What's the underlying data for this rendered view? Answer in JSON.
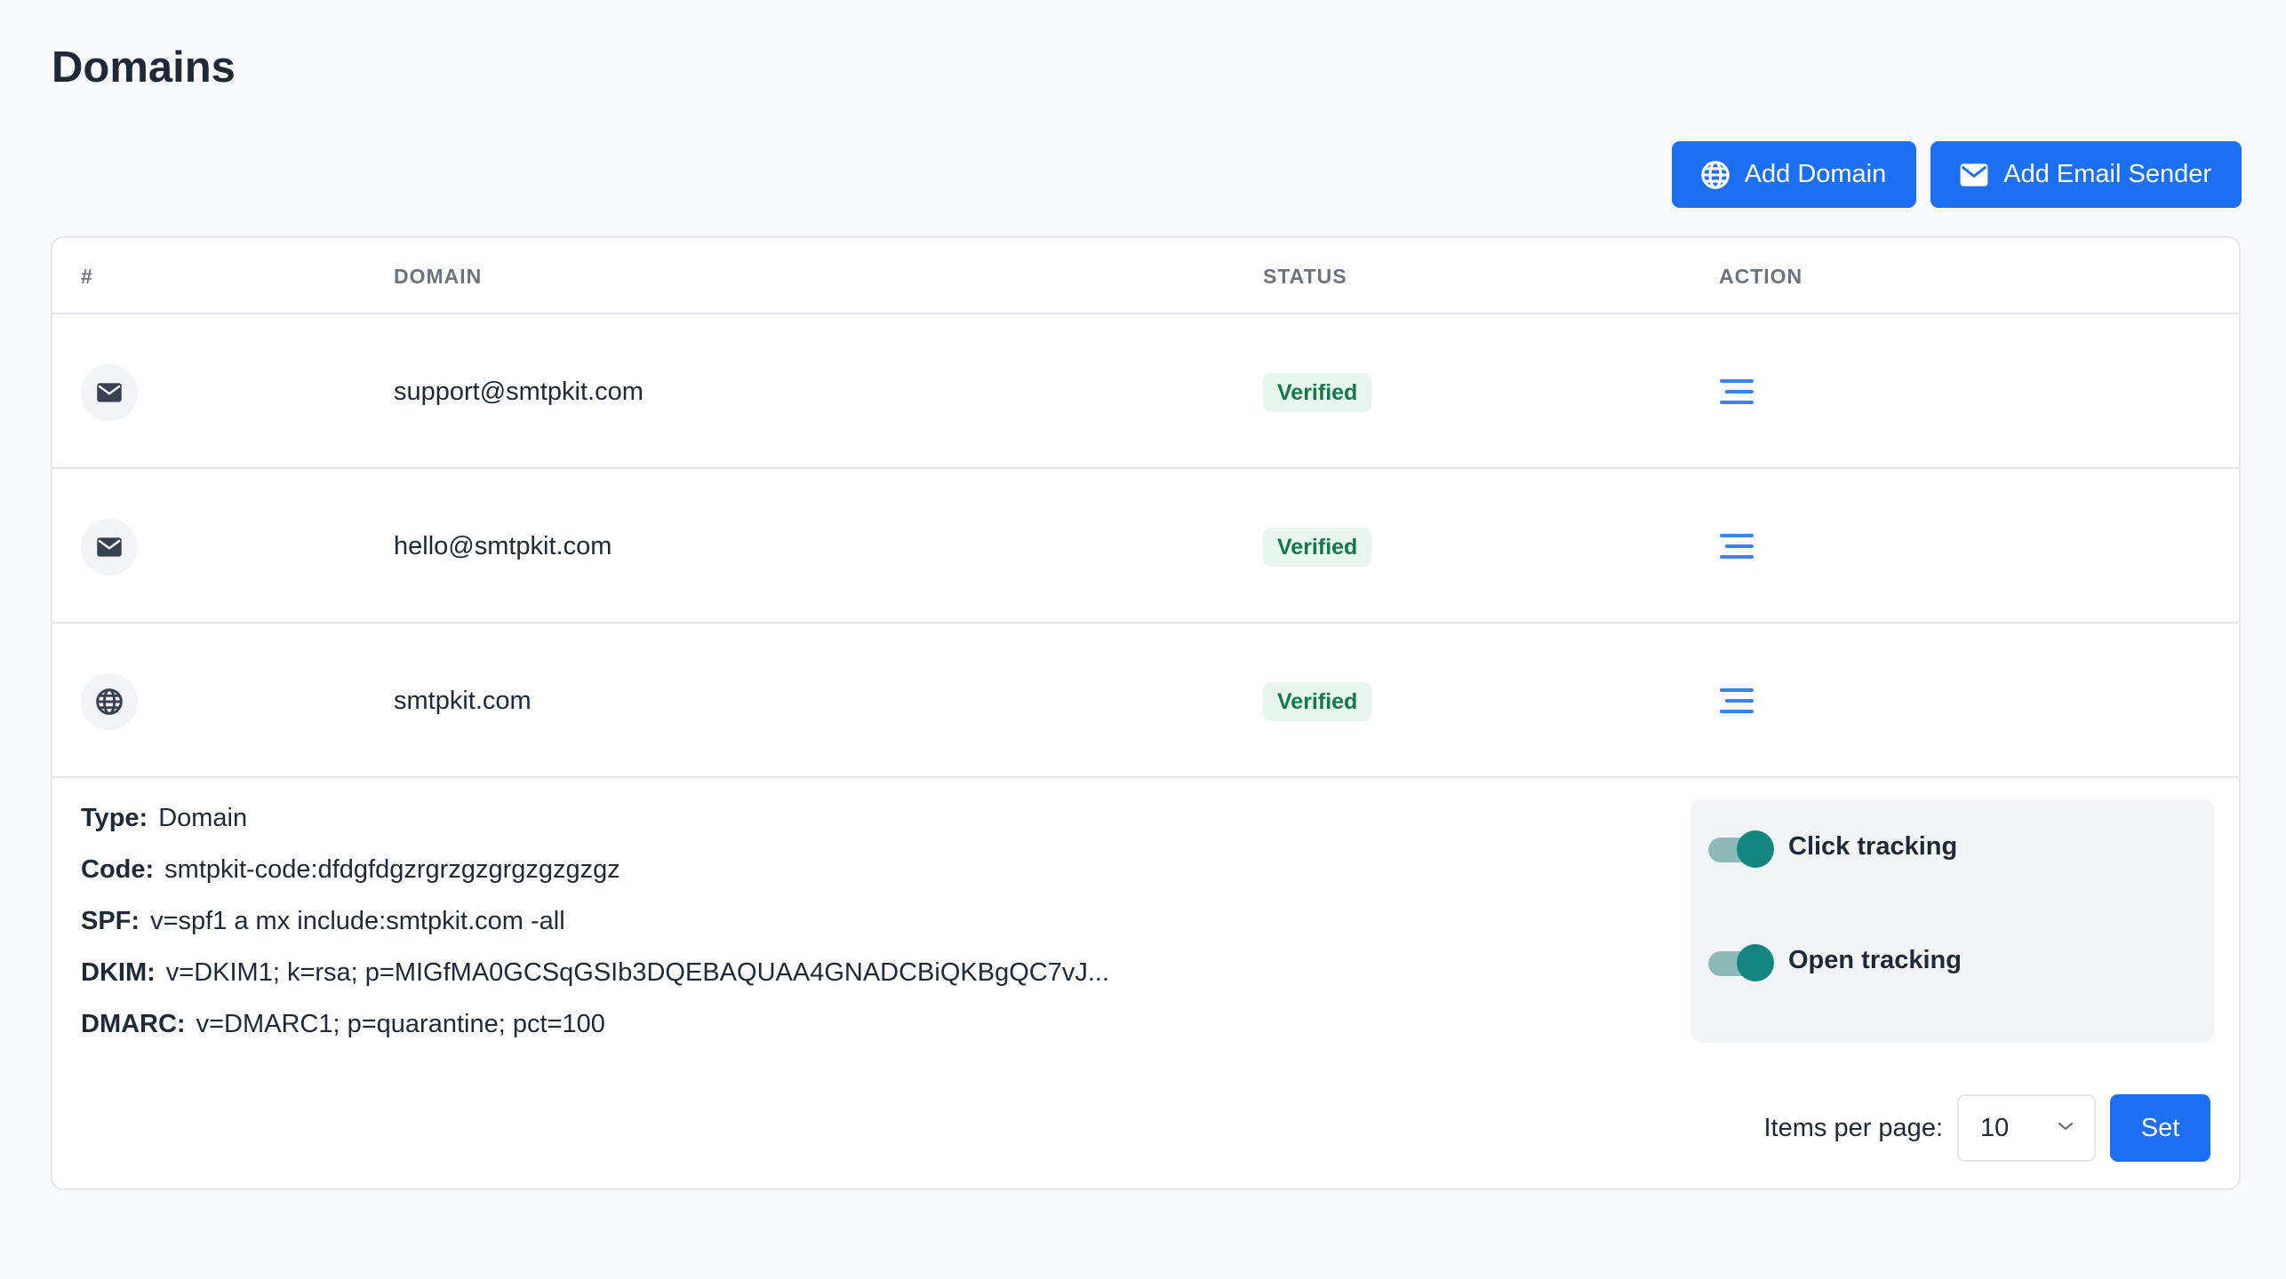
{
  "page": {
    "title": "Domains"
  },
  "toolbar": {
    "add_domain_label": "Add Domain",
    "add_sender_label": "Add Email Sender"
  },
  "table": {
    "headers": {
      "num": "#",
      "domain": "DOMAIN",
      "status": "STATUS",
      "action": "ACTION"
    },
    "rows": [
      {
        "icon": "envelope-icon",
        "domain": "support@smtpkit.com",
        "status": "Verified"
      },
      {
        "icon": "envelope-icon",
        "domain": "hello@smtpkit.com",
        "status": "Verified"
      },
      {
        "icon": "globe-icon",
        "domain": "smtpkit.com",
        "status": "Verified"
      }
    ]
  },
  "details": {
    "type_label": "Type:",
    "type_value": "Domain",
    "code_label": "Code:",
    "code_value": "smtpkit-code:dfdgfdgzrgrzgzgrgzgzgzgz",
    "spf_label": "SPF:",
    "spf_value": "v=spf1 a mx include:smtpkit.com -all",
    "dkim_label": "DKIM:",
    "dkim_value": "v=DKIM1; k=rsa; p=MIGfMA0GCSqGSIb3DQEBAQUAA4GNADCBiQKBgQC7vJ...",
    "dmarc_label": "DMARC:",
    "dmarc_value": "v=DMARC1; p=quarantine; pct=100"
  },
  "tracking": {
    "click_label": "Click tracking",
    "click_enabled": true,
    "open_label": "Open tracking",
    "open_enabled": true
  },
  "pagination": {
    "label": "Items per page:",
    "selected": "10",
    "set_label": "Set"
  },
  "colors": {
    "primary": "#1d6ff2",
    "verified_bg": "#e6f6ee",
    "verified_text": "#13794a",
    "toggle_on": "#11877f",
    "menu_icon": "#3b82f6"
  }
}
